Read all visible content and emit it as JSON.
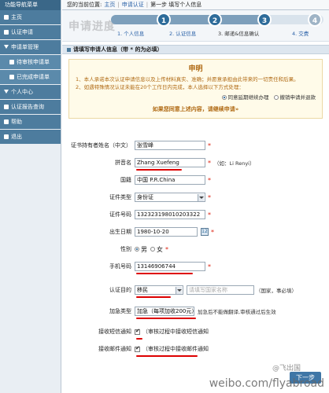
{
  "sidebar": {
    "title": "功能导航菜单",
    "items": [
      {
        "label": "主页"
      },
      {
        "label": "认证申请"
      },
      {
        "label": "申请单管理"
      },
      {
        "label": "待审核申请单"
      },
      {
        "label": "已完成申请单"
      },
      {
        "label": "个人中心"
      },
      {
        "label": "认证报告查询"
      },
      {
        "label": "帮助"
      },
      {
        "label": "退出"
      }
    ]
  },
  "breadcrumb": {
    "prefix": "您的当前位置:",
    "home": "主页",
    "sep": "|",
    "section": "申请认证",
    "step": "第一步 填写个人信息"
  },
  "progress": {
    "title": "申请进度",
    "steps": [
      {
        "num": "1",
        "label": "1. 个人信息"
      },
      {
        "num": "2",
        "label": "2. 认证信息"
      },
      {
        "num": "3",
        "label": "3. 邮递&信息确认"
      },
      {
        "num": "4",
        "label": "4. 交费"
      }
    ]
  },
  "section_title": "请填写申请人信息（带 * 的为必填）",
  "notice": {
    "title": "申明",
    "line1": "1、本人承诺本次认证申请信息以及上传材料真实、准确；并愿意承担由此带来的一切责任和后果。",
    "line2": "2、如遇特殊情况认证未能在20个工作日内完成，本人选择以下方式处理：",
    "option1": "同意延期继续办理",
    "option2": "撤销申请并退款",
    "bottom": "如果您同意上述内容，请继续申请»"
  },
  "form": {
    "cert_name_label": "证书持有者姓名（中文）",
    "cert_name_value": "张雪峰",
    "pinyin_label": "拼音名",
    "pinyin_value": "Zhang Xuefeng",
    "pinyin_hint": "（如：Li Renyi）",
    "country_label": "国籍",
    "country_value": "中国 P.R.China",
    "id_type_label": "证件类型",
    "id_type_value": "身份证",
    "id_no_label": "证件号码",
    "id_no_value": "132323198010203322",
    "birth_label": "出生日期",
    "birth_value": "1980-10-20",
    "calendar_badge": "12",
    "gender_label": "性别",
    "gender_male": "男",
    "gender_female": "女",
    "mobile_label": "手机号码",
    "mobile_value": "13146906744",
    "purpose_label": "认证目的",
    "purpose_value": "移民",
    "country_placeholder": "请填写国家名称",
    "purpose_hint": "（国家，事必填）",
    "urgent_label": "加急类型",
    "urgent_value": "加急（每项加收200元）",
    "urgent_hint": "加急后不能做翻译,审核通过后生效",
    "sms_label": "接收短信通知",
    "sms_text": "（审核过程中接收短信通知",
    "email_label": "接收邮件通知",
    "email_text": "（审核过程中接收邮件通知",
    "asterisk": "*"
  },
  "next_button": "下一步",
  "watermark": {
    "brand": "weibo.com/flyabroad",
    "handle": "@飞出国"
  }
}
